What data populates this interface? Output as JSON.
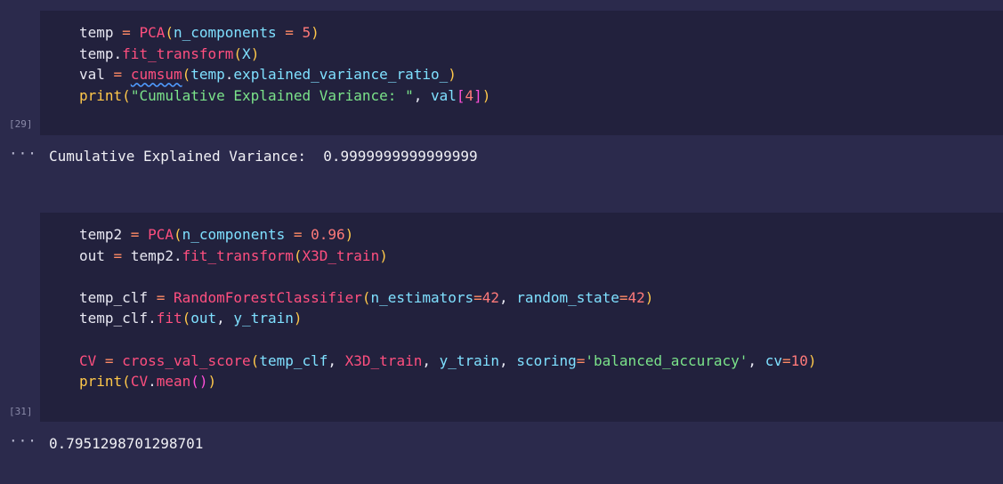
{
  "cells": [
    {
      "execution_count": "[29]",
      "code_lines": [
        [
          {
            "t": "temp",
            "c": "tk-var"
          },
          {
            "t": " = ",
            "c": "tk-op"
          },
          {
            "t": "PCA",
            "c": "tk-fn"
          },
          {
            "t": "(",
            "c": "tk-paren"
          },
          {
            "t": "n_components",
            "c": "tk-param"
          },
          {
            "t": " = ",
            "c": "tk-op"
          },
          {
            "t": "5",
            "c": "tk-num"
          },
          {
            "t": ")",
            "c": "tk-paren"
          }
        ],
        [
          {
            "t": "temp",
            "c": "tk-var"
          },
          {
            "t": ".",
            "c": "tk-plain"
          },
          {
            "t": "fit_transform",
            "c": "tk-method"
          },
          {
            "t": "(",
            "c": "tk-paren"
          },
          {
            "t": "X",
            "c": "tk-param"
          },
          {
            "t": ")",
            "c": "tk-paren"
          }
        ],
        [
          {
            "t": "val",
            "c": "tk-var"
          },
          {
            "t": " = ",
            "c": "tk-op"
          },
          {
            "t": "cumsum",
            "c": "tk-fn squiggle"
          },
          {
            "t": "(",
            "c": "tk-paren"
          },
          {
            "t": "temp",
            "c": "tk-param"
          },
          {
            "t": ".",
            "c": "tk-plain"
          },
          {
            "t": "explained_variance_ratio_",
            "c": "tk-param"
          },
          {
            "t": ")",
            "c": "tk-paren"
          }
        ],
        [
          {
            "t": "print",
            "c": "tk-builtin"
          },
          {
            "t": "(",
            "c": "tk-paren"
          },
          {
            "t": "\"Cumulative Explained Variance: \"",
            "c": "tk-str"
          },
          {
            "t": ", ",
            "c": "tk-plain"
          },
          {
            "t": "val",
            "c": "tk-param"
          },
          {
            "t": "[",
            "c": "tk-bracket"
          },
          {
            "t": "4",
            "c": "tk-num"
          },
          {
            "t": "]",
            "c": "tk-bracket"
          },
          {
            "t": ")",
            "c": "tk-paren"
          }
        ]
      ],
      "output_gutter": "···",
      "output": "Cumulative Explained Variance:  0.9999999999999999"
    },
    {
      "execution_count": "[31]",
      "code_lines": [
        [
          {
            "t": "temp2",
            "c": "tk-var"
          },
          {
            "t": " = ",
            "c": "tk-op"
          },
          {
            "t": "PCA",
            "c": "tk-fn"
          },
          {
            "t": "(",
            "c": "tk-paren"
          },
          {
            "t": "n_components",
            "c": "tk-param"
          },
          {
            "t": " = ",
            "c": "tk-op"
          },
          {
            "t": "0.96",
            "c": "tk-num"
          },
          {
            "t": ")",
            "c": "tk-paren"
          }
        ],
        [
          {
            "t": "out",
            "c": "tk-var"
          },
          {
            "t": " = ",
            "c": "tk-op"
          },
          {
            "t": "temp2",
            "c": "tk-var"
          },
          {
            "t": ".",
            "c": "tk-plain"
          },
          {
            "t": "fit_transform",
            "c": "tk-method"
          },
          {
            "t": "(",
            "c": "tk-paren"
          },
          {
            "t": "X3D_train",
            "c": "tk-fn"
          },
          {
            "t": ")",
            "c": "tk-paren"
          }
        ],
        [],
        [
          {
            "t": "temp_clf",
            "c": "tk-var"
          },
          {
            "t": " = ",
            "c": "tk-op"
          },
          {
            "t": "RandomForestClassifier",
            "c": "tk-fn"
          },
          {
            "t": "(",
            "c": "tk-paren"
          },
          {
            "t": "n_estimators",
            "c": "tk-param"
          },
          {
            "t": "=",
            "c": "tk-op"
          },
          {
            "t": "42",
            "c": "tk-num"
          },
          {
            "t": ", ",
            "c": "tk-plain"
          },
          {
            "t": "random_state",
            "c": "tk-param"
          },
          {
            "t": "=",
            "c": "tk-op"
          },
          {
            "t": "42",
            "c": "tk-num"
          },
          {
            "t": ")",
            "c": "tk-paren"
          }
        ],
        [
          {
            "t": "temp_clf",
            "c": "tk-var"
          },
          {
            "t": ".",
            "c": "tk-plain"
          },
          {
            "t": "fit",
            "c": "tk-method"
          },
          {
            "t": "(",
            "c": "tk-paren"
          },
          {
            "t": "out",
            "c": "tk-param"
          },
          {
            "t": ", ",
            "c": "tk-plain"
          },
          {
            "t": "y_train",
            "c": "tk-param"
          },
          {
            "t": ")",
            "c": "tk-paren"
          }
        ],
        [],
        [
          {
            "t": "CV",
            "c": "tk-fn"
          },
          {
            "t": " = ",
            "c": "tk-op"
          },
          {
            "t": "cross_val_score",
            "c": "tk-fn"
          },
          {
            "t": "(",
            "c": "tk-paren"
          },
          {
            "t": "temp_clf",
            "c": "tk-param"
          },
          {
            "t": ", ",
            "c": "tk-plain"
          },
          {
            "t": "X3D_train",
            "c": "tk-fn"
          },
          {
            "t": ", ",
            "c": "tk-plain"
          },
          {
            "t": "y_train",
            "c": "tk-param"
          },
          {
            "t": ", ",
            "c": "tk-plain"
          },
          {
            "t": "scoring",
            "c": "tk-param"
          },
          {
            "t": "=",
            "c": "tk-op"
          },
          {
            "t": "'balanced_accuracy'",
            "c": "tk-str"
          },
          {
            "t": ", ",
            "c": "tk-plain"
          },
          {
            "t": "cv",
            "c": "tk-param"
          },
          {
            "t": "=",
            "c": "tk-op"
          },
          {
            "t": "10",
            "c": "tk-num"
          },
          {
            "t": ")",
            "c": "tk-paren"
          }
        ],
        [
          {
            "t": "print",
            "c": "tk-builtin"
          },
          {
            "t": "(",
            "c": "tk-paren"
          },
          {
            "t": "CV",
            "c": "tk-fn"
          },
          {
            "t": ".",
            "c": "tk-plain"
          },
          {
            "t": "mean",
            "c": "tk-method"
          },
          {
            "t": "(",
            "c": "tk-bracket"
          },
          {
            "t": ")",
            "c": "tk-bracket"
          },
          {
            "t": ")",
            "c": "tk-paren"
          }
        ]
      ],
      "output_gutter": "···",
      "output": "0.7951298701298701"
    }
  ],
  "colors": {
    "page_bg": "#2b2a4c",
    "cell_bg": "#22213d",
    "keyword_pink": "#ff4f7f",
    "operator_orange": "#ff8a65",
    "paren_yellow": "#ffc84a",
    "param_cyan": "#7fe0ff",
    "string_green": "#7be38a",
    "number_red": "#ff7a7a"
  }
}
